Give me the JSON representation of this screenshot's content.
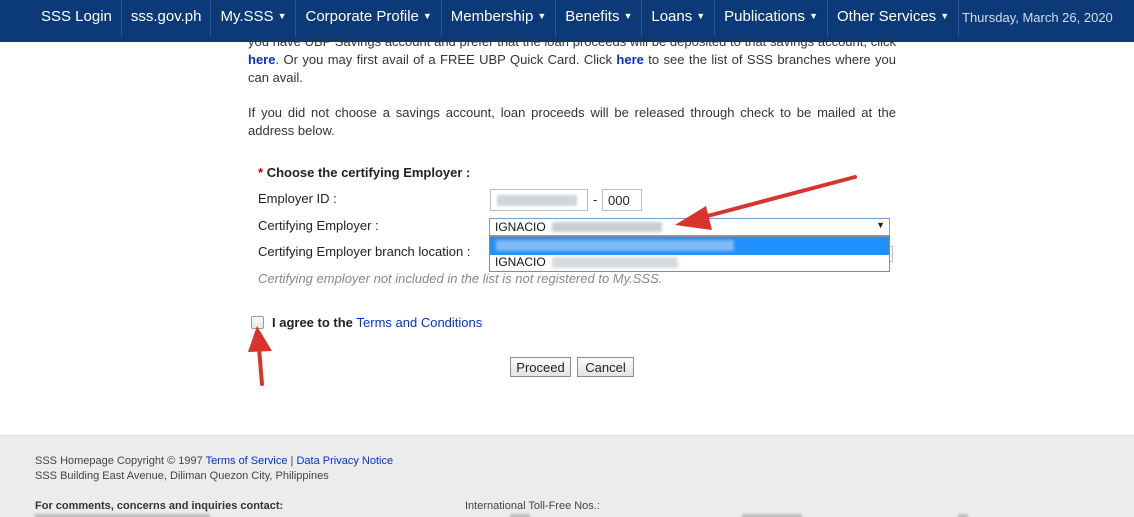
{
  "nav": {
    "items": [
      {
        "label": "SSS Login",
        "dropdown": false
      },
      {
        "label": "sss.gov.ph",
        "dropdown": false
      },
      {
        "label": "My.SSS",
        "dropdown": true
      },
      {
        "label": "Corporate Profile",
        "dropdown": true
      },
      {
        "label": "Membership",
        "dropdown": true
      },
      {
        "label": "Benefits",
        "dropdown": true
      },
      {
        "label": "Loans",
        "dropdown": true
      },
      {
        "label": "Publications",
        "dropdown": true
      },
      {
        "label": "Other Services",
        "dropdown": true
      }
    ],
    "date": "Thursday, March 26, 2020",
    "bg_color": "#0c3a78"
  },
  "content": {
    "para1_a": "you have UBP Savings account and prefer that the loan proceeds will be deposited to that savings account, click ",
    "para1_link1": "here",
    "para1_b": ". Or you may first avail of a FREE UBP Quick Card. Click ",
    "para1_link2": "here",
    "para1_c": " to see the list of SSS branches where you can avail.",
    "para2": "If you did not choose a savings account, loan proceeds will be released through check to be mailed at the address below.",
    "required_marker": "*",
    "section_title": "Choose the certifying Employer :",
    "employer_id_label": "Employer ID :",
    "employer_id_dash": "-",
    "employer_id_suffix": "000",
    "certifying_employer_label": "Certifying Employer :",
    "certifying_employer_value": "IGNACIO",
    "dropdown_option_2": "IGNACIO",
    "branch_label": "Certifying Employer branch location :",
    "note": "Certifying employer not included in the list is not registered to My.SSS.",
    "agree_text": "I agree to the ",
    "agree_link": "Terms and Conditions",
    "proceed_label": "Proceed",
    "cancel_label": "Cancel"
  },
  "footer": {
    "copyright": "SSS Homepage Copyright © 1997 ",
    "terms_link": "Terms of Service",
    "separator": " | ",
    "privacy_link": "Data Privacy Notice",
    "address": "SSS Building East Avenue, Diliman Quezon City, Philippines",
    "comments": "For comments, concerns and inquiries contact:",
    "toll_free": "International Toll-Free Nos.:"
  },
  "colors": {
    "link": "#0033cc",
    "arrow": "#d9342b",
    "highlight": "#1e90ff"
  }
}
